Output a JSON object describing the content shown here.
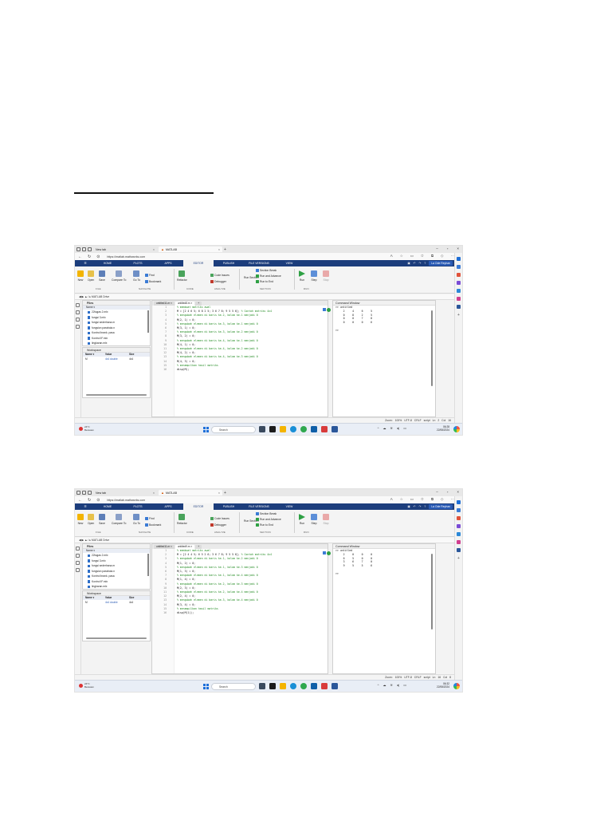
{
  "screens": [
    {
      "browser_tabs": [
        {
          "label": "New tab"
        },
        {
          "label": "MATLAB"
        }
      ],
      "url": "https://matlab.mathworks.com",
      "matlab_tabs": [
        "HOME",
        "PLOTS",
        "APPS",
        "EDITOR",
        "PUBLISH",
        "FILE VERSIONS",
        "VIEW"
      ],
      "active_matlab_tab": "EDITOR",
      "user": "La Ode Reyhan",
      "tools": {
        "new": "New",
        "open": "Open",
        "save": "Save",
        "compare": "Compare To",
        "goto": "Go To",
        "find": "Find",
        "bookmark": "Bookmark",
        "refactor": "Refactor",
        "code_issues": "Code Issues",
        "debugger": "Debugger",
        "run_section": "Run Section",
        "section_break": "Section Break",
        "run_advance": "Run and Advance",
        "run_end": "Run to End",
        "run": "Run",
        "step": "Step",
        "stop": "Stop"
      },
      "section_labels": [
        "FILE",
        "NAVIGATE",
        "CODE",
        "ANALYZE",
        "SECTION",
        "RUN"
      ],
      "path": "/ ▸ MATLAB Drive",
      "files_title": "Files",
      "files_col": "Name ▾",
      "files": [
        "22tugas 2.mlx",
        "fungsi 3.mlx",
        "fungsi sederhana.m",
        "fungsion parabola.n",
        "Kontrol brank. pasa",
        "Kontrol IF.mlx",
        "lingkaran.mlx",
        "M-File.mlx"
      ],
      "workspace_title": "Workspace",
      "workspace_cols": [
        "Name ▾",
        "Value",
        "Size"
      ],
      "workspace_row": [
        "M",
        "4x4 double",
        "4x4"
      ],
      "editor_tabs": [
        "untitled11.m ×",
        "untitled8.m ×",
        "+"
      ],
      "code": [
        {
          "t": "% membuat matriks awal",
          "k": "cm"
        },
        {
          "t": "M = [2 4 6 5; 6 8 2 5; 3 6 7 8; 9 5 5 6]; % Contoh matriks 4x4",
          "k": "mix"
        },
        {
          "t": "% mengubah elemen di baris ke-2, kolom ke-1 menjadi 0",
          "k": "cm"
        },
        {
          "t": "M(2, 1) = 0;",
          "k": "n"
        },
        {
          "t": "% mengubah elemen di baris ke-3, kolom ke-1 menjadi 0",
          "k": "cm"
        },
        {
          "t": "M(3, 1) = 0;",
          "k": "n"
        },
        {
          "t": "% mengubah elemen di baris ke-3, kolom ke-2 menjadi 0",
          "k": "cm"
        },
        {
          "t": "M(3, 2) = 0;",
          "k": "n"
        },
        {
          "t": "% mengubah elemen di baris ke-4, kolom ke-1 menjadi 0",
          "k": "cm"
        },
        {
          "t": "M(4, 1) = 0;",
          "k": "n"
        },
        {
          "t": "% mengubah elemen di baris ke-4, kolom ke-2 menjadi 0",
          "k": "cm"
        },
        {
          "t": "M(4, 2) = 0;",
          "k": "n"
        },
        {
          "t": "% mengubah elemen di baris ke-4, kolom ke-3 menjadi 0",
          "k": "cm"
        },
        {
          "t": "M(4, 3) = 0;",
          "k": "n"
        },
        {
          "t": "% menampilkan hasil matriks",
          "k": "cm"
        },
        {
          "t": "disp(M);",
          "k": "n"
        }
      ],
      "cmd_title": "Command Window",
      "cmd_lines": [
        ">> untitled",
        "     2     4     6     5",
        "     0     8     2     5",
        "     0     0     7     8",
        "     0     0     0     6",
        "",
        ">>"
      ],
      "status": "Zoom: 100%  UTF-8  CRLF  script  Ln 2  Col 16",
      "weather_temp": "24°C",
      "weather_desc": "Berawan",
      "search": "Search",
      "time": "06:28",
      "date": "22/06/2024"
    },
    {
      "browser_tabs": [
        {
          "label": "New tab"
        },
        {
          "label": "MATLAB"
        }
      ],
      "url": "https://matlab.mathworks.com",
      "matlab_tabs": [
        "HOME",
        "PLOTS",
        "APPS",
        "EDITOR",
        "PUBLISH",
        "FILE VERSIONS",
        "VIEW"
      ],
      "active_matlab_tab": "EDITOR",
      "user": "La Ode Reyhan",
      "tools": {
        "new": "New",
        "open": "Open",
        "save": "Save",
        "compare": "Compare To",
        "goto": "Go To",
        "find": "Find",
        "bookmark": "Bookmark",
        "refactor": "Refactor",
        "code_issues": "Code Issues",
        "debugger": "Debugger",
        "run_section": "Run Section",
        "section_break": "Section Break",
        "run_advance": "Run and Advance",
        "run_end": "Run to End",
        "run": "Run",
        "step": "Step",
        "stop": "Stop"
      },
      "section_labels": [
        "FILE",
        "NAVIGATE",
        "CODE",
        "ANALYZE",
        "SECTION",
        "RUN"
      ],
      "path": "/ ▸ MATLAB Drive",
      "files_title": "Files",
      "files_col": "Name ▾",
      "files": [
        "22tugas 2.mlx",
        "fungsi 3.mlx",
        "fungsi sederhana.m",
        "fungsion parabola.n",
        "Kontrol brank. pasa",
        "Kontrol IF.mlx",
        "lingkaran.mlx",
        "M-File.mlx"
      ],
      "workspace_title": "Workspace",
      "workspace_cols": [
        "Name ▾",
        "Value",
        "Size"
      ],
      "workspace_row": [
        "M",
        "4x4 double",
        "4x4"
      ],
      "editor_tabs": [
        "untitled11.m ×",
        "untitled9.m ×",
        "+"
      ],
      "code": [
        {
          "t": "% membuat matriks awal",
          "k": "cm"
        },
        {
          "t": "M = [2 4 4 5; 6 5 2 6; 3 6 7 8; 9 5 5 6]; % Contoh matriks 4x4",
          "k": "mix"
        },
        {
          "t": "% mengubah elemen di baris ke-1, kolom ke-2 menjadi 0",
          "k": "cm"
        },
        {
          "t": "M(1, 2) = 0;",
          "k": "n"
        },
        {
          "t": "% mengubah elemen di baris ke-1, kolom ke-3 menjadi 0",
          "k": "cm"
        },
        {
          "t": "M(1, 3) = 0;",
          "k": "n"
        },
        {
          "t": "% mengubah elemen di baris ke-1, kolom ke-4 menjadi 0",
          "k": "cm"
        },
        {
          "t": "M(1, 4) = 0;",
          "k": "n"
        },
        {
          "t": "% mengubah elemen di baris ke-2, kolom ke-3 menjadi 0",
          "k": "cm"
        },
        {
          "t": "M(2, 3) = 0;",
          "k": "n"
        },
        {
          "t": "% mengubah elemen di baris ke-2, kolom ke-4 menjadi 0",
          "k": "cm"
        },
        {
          "t": "M(2, 4) = 0;",
          "k": "n"
        },
        {
          "t": "% mengubah elemen di baris ke-3, kolom ke-4 menjadi 0",
          "k": "cm"
        },
        {
          "t": "M(3, 4) = 0;",
          "k": "n"
        },
        {
          "t": "% menampilkan hasil matriks",
          "k": "cm"
        },
        {
          "t": "disp(M(1));",
          "k": "n"
        }
      ],
      "cmd_title": "Command Window",
      "cmd_lines": [
        ">> untitled",
        "     2     0     0     0",
        "     6     5     0     0",
        "     3     6     7     0",
        "     9     5     5     6",
        "",
        ">>"
      ],
      "status": "Zoom: 100%  UTF-8  CRLF  script  Ln 16  Col 8",
      "weather_temp": "24°C",
      "weather_desc": "Berawan",
      "search": "Search",
      "time": "06:32",
      "date": "22/06/2024"
    }
  ],
  "colors": {
    "matlab_blue": "#1c3d7c",
    "comment_green": "#228b22",
    "windows_blue": "#1e6fd9"
  }
}
